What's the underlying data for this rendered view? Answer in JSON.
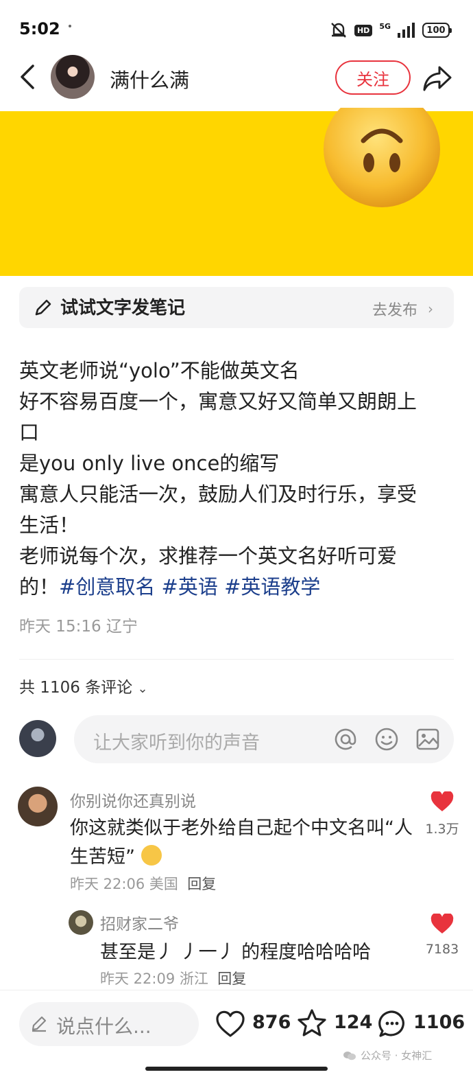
{
  "status": {
    "time": "5:02",
    "network": "5G",
    "hd": "HD",
    "battery": "100"
  },
  "header": {
    "author": "满什么满",
    "follow_label": "关注"
  },
  "try_bar": {
    "label": "试试文字发笔记",
    "action": "去发布"
  },
  "post": {
    "lines": [
      "英文老师说“yolo”不能做英文名",
      "好不容易百度一个，寓意又好又简单又朗朗上",
      "口",
      "是you only live once的缩写",
      "寓意人只能活一次，鼓励人们及时行乐，享受",
      "生活！",
      "老师说每个次，求推荐一个英文名好听可爱"
    ],
    "last_line_prefix": "的！",
    "tags": [
      "#创意取名",
      "#英语",
      "#英语教学"
    ],
    "meta": "昨天 15:16 辽宁"
  },
  "comments_header": "共 1106 条评论",
  "comment_input": {
    "placeholder": "让大家听到你的声音"
  },
  "comments": [
    {
      "name": "你别说你还真别说",
      "text": "你这就类似于老外给自己起个中文名叫“人生苦短”",
      "date": "昨天 22:06 美国",
      "reply_label": "回复",
      "likes": "1.3万",
      "replies": [
        {
          "name": "招财家二爷",
          "text": "甚至是丿 丿一丿 的程度哈哈哈哈",
          "date": "昨天 22:09 浙江",
          "reply_label": "回复",
          "likes": "7183"
        }
      ]
    }
  ],
  "bottom_bar": {
    "placeholder": "说点什么...",
    "likes": "876",
    "stars": "124",
    "comments": "1106"
  },
  "watermark": "公众号 · 女神汇",
  "colors": {
    "accent": "#e8333d",
    "hero_bg": "#ffd600",
    "tag": "#1c3f8c"
  }
}
